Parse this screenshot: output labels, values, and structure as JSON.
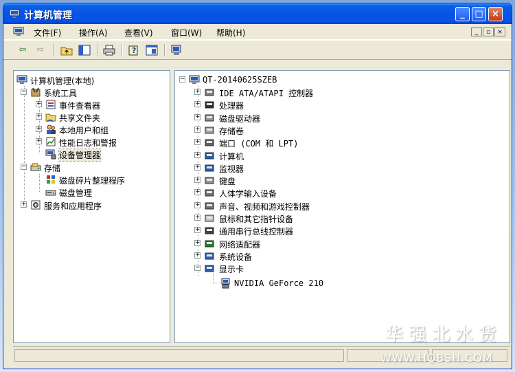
{
  "window": {
    "title": "计算机管理"
  },
  "menubar": {
    "items": [
      "文件(F)",
      "操作(A)",
      "查看(V)",
      "窗口(W)",
      "帮助(H)"
    ],
    "mdi_buttons": [
      "_",
      "▫",
      "×"
    ]
  },
  "toolbar": {
    "buttons": [
      "back-icon",
      "forward-icon",
      "up-folder-icon",
      "show-hide-tree-icon",
      "print-icon",
      "help-icon",
      "properties-icon",
      "scan-hardware-icon"
    ]
  },
  "left_tree": {
    "root": "计算机管理(本地)",
    "system_tools": "系统工具",
    "event_viewer": "事件查看器",
    "shared_folders": "共享文件夹",
    "local_users": "本地用户和组",
    "perf_logs": "性能日志和警报",
    "device_manager": "设备管理器",
    "storage": "存储",
    "defrag": "磁盘碎片整理程序",
    "disk_mgmt": "磁盘管理",
    "services_apps": "服务和应用程序"
  },
  "right_tree": {
    "computer_name": "QT-20140625SZEB",
    "categories": [
      "IDE ATA/ATAPI 控制器",
      "处理器",
      "磁盘驱动器",
      "存储卷",
      "端口 (COM 和 LPT)",
      "计算机",
      "监视器",
      "键盘",
      "人体学输入设备",
      "声音、视频和游戏控制器",
      "鼠标和其它指针设备",
      "通用串行总线控制器",
      "网络适配器",
      "系统设备",
      "显示卡"
    ],
    "display_child": "NVIDIA GeForce 210"
  },
  "watermark": {
    "line1": "华强北水货",
    "line2": "WWW.HQBSH.COM"
  },
  "colors": {
    "titlebar": "#0754e0",
    "face": "#ece9d8",
    "close": "#c5371a"
  }
}
